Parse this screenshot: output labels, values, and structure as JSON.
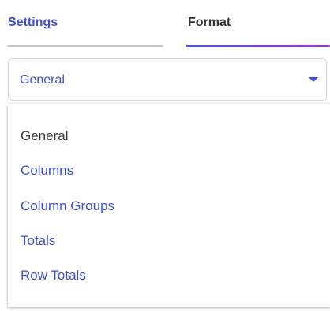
{
  "tabs": [
    {
      "label": "Settings",
      "active": false
    },
    {
      "label": "Format",
      "active": true
    }
  ],
  "select": {
    "value": "General",
    "caret_icon": "caret-down-icon"
  },
  "dropdown": {
    "options": [
      {
        "label": "General",
        "selected": true
      },
      {
        "label": "Columns",
        "selected": false
      },
      {
        "label": "Column Groups",
        "selected": false
      },
      {
        "label": "Totals",
        "selected": false
      },
      {
        "label": "Row Totals",
        "selected": false
      }
    ]
  },
  "colors": {
    "accent": "#3b4fd8",
    "text": "#333333",
    "inactive_underline": "#c9c9c9",
    "active_underline_start": "#4a4ff0",
    "active_underline_end": "#9a35d8"
  }
}
